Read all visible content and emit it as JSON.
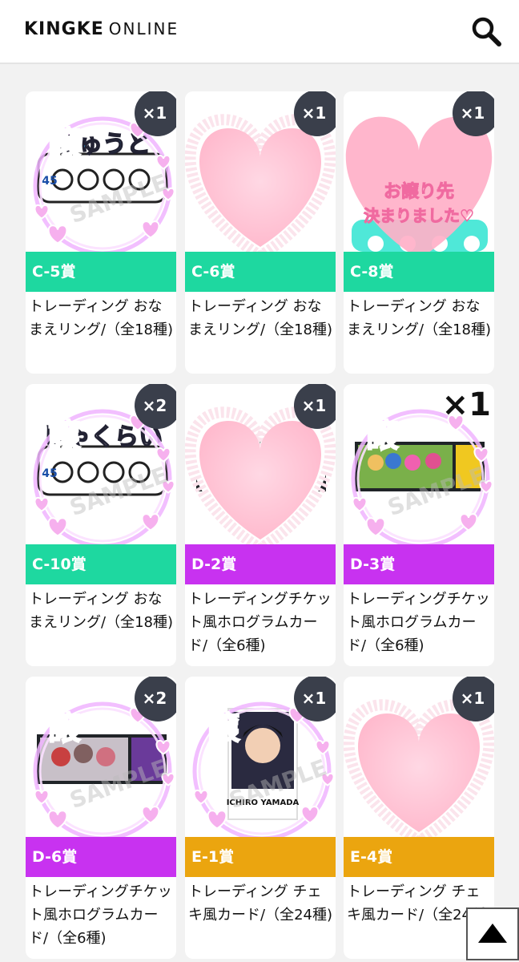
{
  "header": {
    "logo_main": "KINGKE",
    "logo_sub": "ONLINE"
  },
  "colors": {
    "c_prize": "#1ed8a0",
    "d_prize": "#c832f0",
    "e_prize": "#eba50f",
    "qty_badge": "#3a3f4b",
    "heart_pink": "#ffc8d8",
    "frame_pink": "#f0b4ff"
  },
  "cards": [
    {
      "prize": "C-5賞",
      "title": "トレーディング おなまえリング/（全18種)",
      "qty": "×1",
      "color": "c",
      "overlay": "yuzuru",
      "image": "name-ring-jyuuto"
    },
    {
      "prize": "C-6賞",
      "title": "トレーディング おなまえリング/（全18種)",
      "qty": "×1",
      "color": "c",
      "overlay": "heart",
      "image": "hidden"
    },
    {
      "prize": "C-8賞",
      "title": "トレーディング おなまえリング/（全18種)",
      "qty": "×1",
      "color": "c",
      "overlay": "done",
      "image": "name-ring-rensho"
    },
    {
      "prize": "C-10賞",
      "title": "トレーディング おなまえリング/（全18種)",
      "qty": "×2",
      "color": "c",
      "overlay": "yuzuru",
      "image": "name-ring-jakurai"
    },
    {
      "prize": "D-2賞",
      "title": "トレーディングチケット風ホログラムカード/（全6種)",
      "qty": "×1",
      "color": "d",
      "overlay": "heart",
      "image": "ticket-card"
    },
    {
      "prize": "D-3賞",
      "title": "トレーディングチケット風ホログラムカード/（全6種)",
      "qty": "×1",
      "color": "d",
      "overlay": "yuzuru",
      "image": "ticket-card-group",
      "big_qty": true
    },
    {
      "prize": "D-6賞",
      "title": "トレーディングチケット風ホログラムカード/（全6種)",
      "qty": "×2",
      "color": "d",
      "overlay": "yuzuru",
      "image": "ticket-card-trio"
    },
    {
      "prize": "E-1賞",
      "title": "トレーディング チェキ風カード/（全24種)",
      "qty": "×1",
      "color": "e",
      "overlay": "yuzuru",
      "image": "cheki-ichiro"
    },
    {
      "prize": "E-4賞",
      "title": "トレーディング チェキ風カード/（全24種)",
      "qty": "×1",
      "color": "e",
      "overlay": "heart",
      "image": "hidden"
    }
  ],
  "overlay_text": {
    "yuzuru": "譲",
    "done_line1": "お譲り先",
    "done_line2": "決まりました♡",
    "ring_jyuuto": "じゅうと",
    "ring_jakurai": "じゃくらい",
    "ring_num_45": "45",
    "cheki_name": "ICHIRO YAMADA",
    "sample": "SAMPLE"
  },
  "scroll_top_icon": "triangle-up-icon",
  "search_icon": "search-icon"
}
